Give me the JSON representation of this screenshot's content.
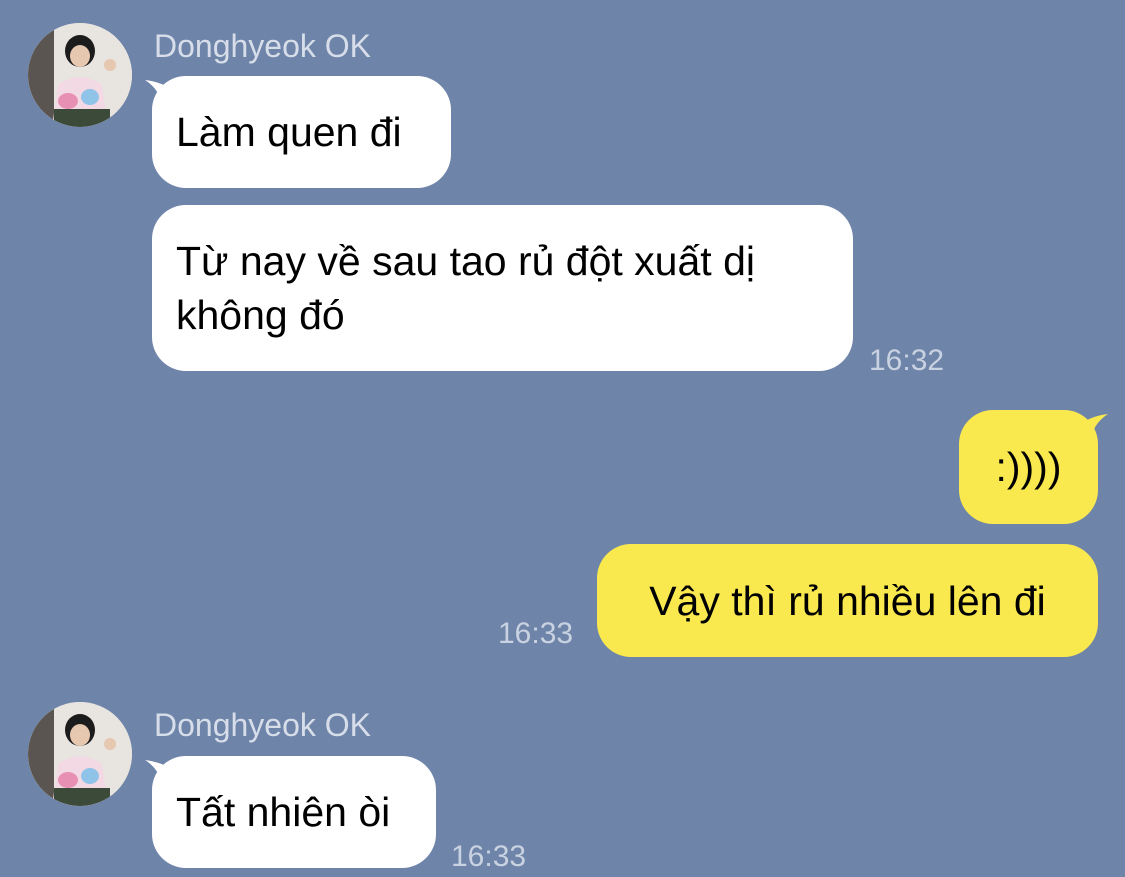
{
  "colors": {
    "background": "#6e84a9",
    "incoming_bubble": "#ffffff",
    "outgoing_bubble": "#fae84f",
    "meta_text": "#d7deea"
  },
  "messages": {
    "group1": {
      "sender": "Donghyeok OK",
      "msg1": "Làm quen đi",
      "msg2": "Từ nay về sau tao rủ đột xuất dị không đó",
      "time": "16:32"
    },
    "group2": {
      "msg1": ":))))",
      "msg2": "Vậy thì rủ nhiều lên đi",
      "time": "16:33"
    },
    "group3": {
      "sender": "Donghyeok OK",
      "msg1": "Tất nhiên òi",
      "time": "16:33"
    }
  }
}
